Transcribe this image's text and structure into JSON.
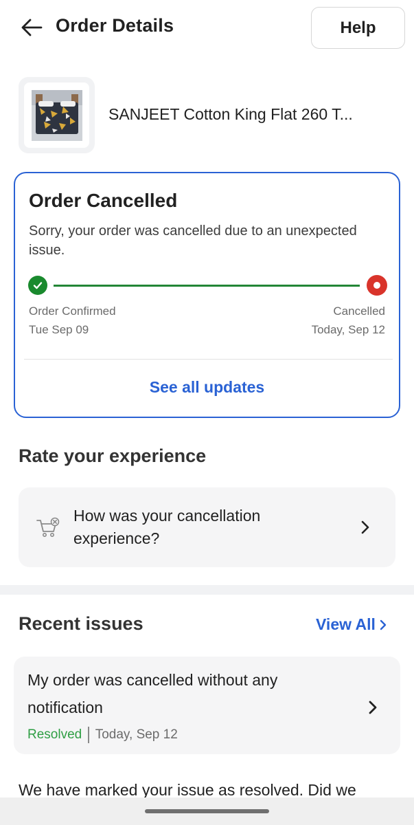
{
  "header": {
    "title": "Order Details",
    "help_label": "Help"
  },
  "product": {
    "title": "SANJEET Cotton King Flat 260 T..."
  },
  "status": {
    "title": "Order Cancelled",
    "message": "Sorry, your order was cancelled due to an unexpected issue.",
    "timeline": {
      "start_label": "Order Confirmed",
      "start_date": "Tue Sep 09",
      "end_label": "Cancelled",
      "end_date": "Today, Sep 12"
    },
    "see_all_label": "See all updates"
  },
  "rate": {
    "heading": "Rate your experience",
    "question": "How was your cancellation experience?"
  },
  "issues": {
    "heading": "Recent issues",
    "view_all_label": "View All",
    "items": [
      {
        "text": "My order was cancelled without any notification",
        "status": "Resolved",
        "date": "Today, Sep 12"
      }
    ]
  },
  "resolved_message": "We have marked your issue as resolved. Did we",
  "colors": {
    "accent": "#2a62d4",
    "success": "#1a8a2e",
    "danger": "#d9342b",
    "resolved": "#2f9e44"
  }
}
